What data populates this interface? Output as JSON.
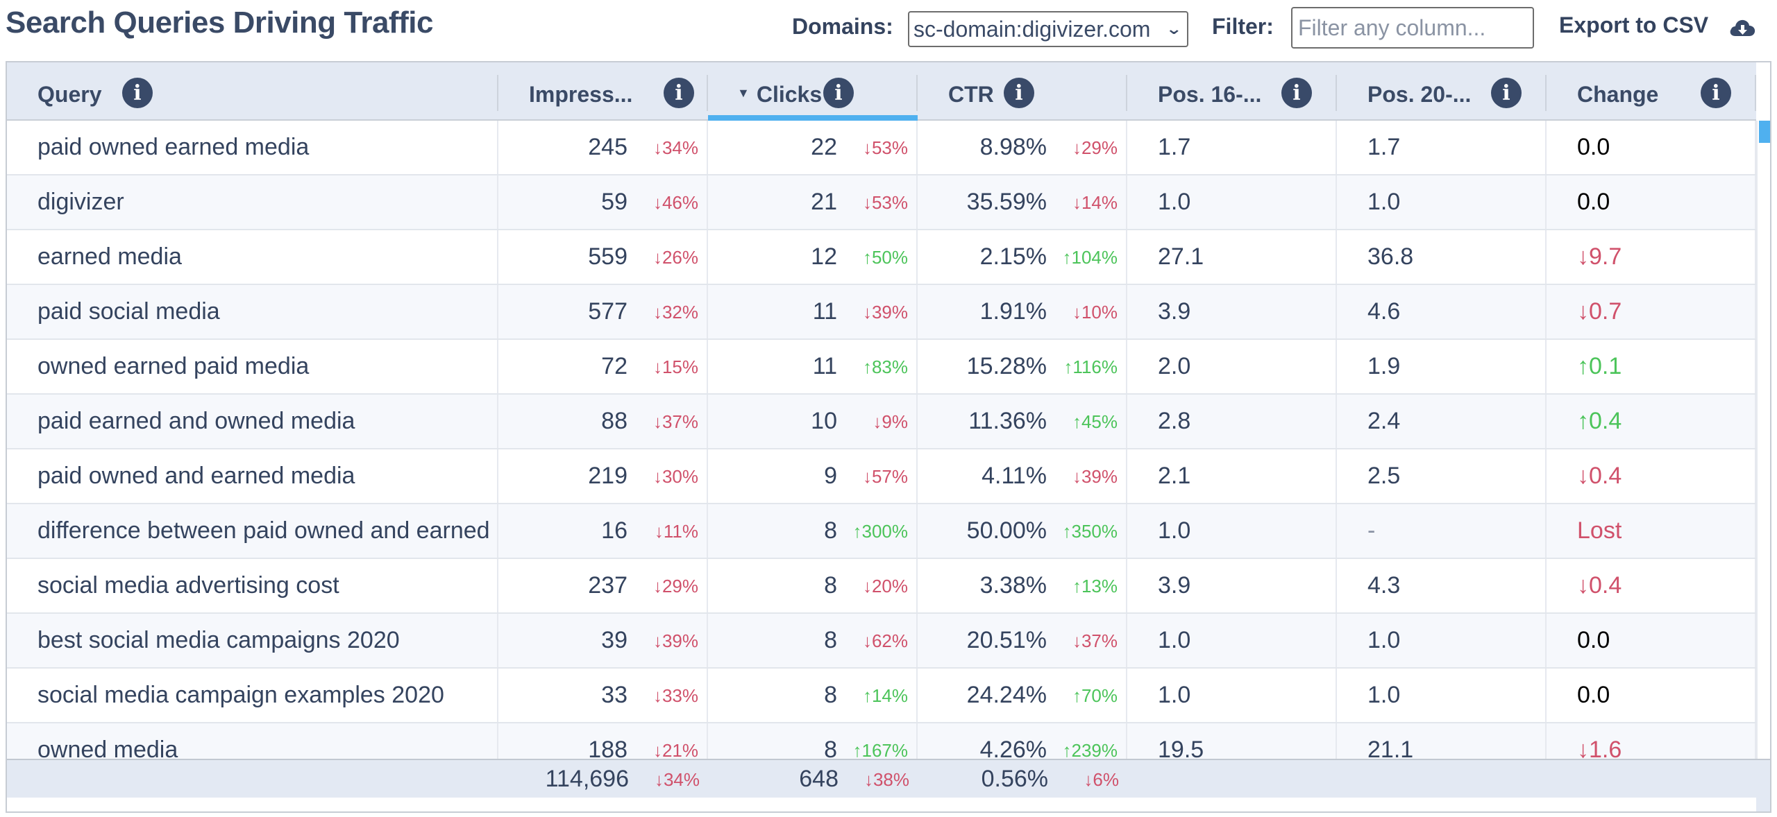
{
  "title": "Search Queries Driving Traffic",
  "toolbar": {
    "domains_label": "Domains:",
    "domain_selected": "sc-domain:digivizer.com",
    "filter_label": "Filter:",
    "filter_placeholder": "Filter any column...",
    "filter_value": "",
    "export_label": "Export to CSV",
    "export_icon": "cloud-download-icon"
  },
  "colors": {
    "accent": "#4fb0ef",
    "header_bg": "#e3e9f3",
    "text": "#34435e",
    "up": "#4cc45a",
    "down": "#d0516b"
  },
  "columns": [
    {
      "key": "query",
      "label": "Query",
      "sorted": false
    },
    {
      "key": "impressions",
      "label": "Impress...",
      "sorted": false
    },
    {
      "key": "clicks",
      "label": "Clicks",
      "sorted": true,
      "sort_dir": "desc"
    },
    {
      "key": "ctr",
      "label": "CTR",
      "sorted": false
    },
    {
      "key": "pos_a",
      "label": "Pos. 16-...",
      "sorted": false
    },
    {
      "key": "pos_b",
      "label": "Pos. 20-...",
      "sorted": false
    },
    {
      "key": "change",
      "label": "Change",
      "sorted": false
    }
  ],
  "rows": [
    {
      "query": "paid owned earned media",
      "impressions": "245",
      "imp_delta": "↓34%",
      "imp_dir": "down",
      "clicks": "22",
      "clk_delta": "↓53%",
      "clk_dir": "down",
      "ctr": "8.98%",
      "ctr_delta": "↓29%",
      "ctr_dir": "down",
      "pos_a": "1.7",
      "pos_b": "1.7",
      "change": "0.0",
      "change_dir": "neutral"
    },
    {
      "query": "digivizer",
      "impressions": "59",
      "imp_delta": "↓46%",
      "imp_dir": "down",
      "clicks": "21",
      "clk_delta": "↓53%",
      "clk_dir": "down",
      "ctr": "35.59%",
      "ctr_delta": "↓14%",
      "ctr_dir": "down",
      "pos_a": "1.0",
      "pos_b": "1.0",
      "change": "0.0",
      "change_dir": "neutral"
    },
    {
      "query": "earned media",
      "impressions": "559",
      "imp_delta": "↓26%",
      "imp_dir": "down",
      "clicks": "12",
      "clk_delta": "↑50%",
      "clk_dir": "up",
      "ctr": "2.15%",
      "ctr_delta": "↑104%",
      "ctr_dir": "up",
      "pos_a": "27.1",
      "pos_b": "36.8",
      "change": "↓9.7",
      "change_dir": "down"
    },
    {
      "query": "paid social media",
      "impressions": "577",
      "imp_delta": "↓32%",
      "imp_dir": "down",
      "clicks": "11",
      "clk_delta": "↓39%",
      "clk_dir": "down",
      "ctr": "1.91%",
      "ctr_delta": "↓10%",
      "ctr_dir": "down",
      "pos_a": "3.9",
      "pos_b": "4.6",
      "change": "↓0.7",
      "change_dir": "down"
    },
    {
      "query": "owned earned paid media",
      "impressions": "72",
      "imp_delta": "↓15%",
      "imp_dir": "down",
      "clicks": "11",
      "clk_delta": "↑83%",
      "clk_dir": "up",
      "ctr": "15.28%",
      "ctr_delta": "↑116%",
      "ctr_dir": "up",
      "pos_a": "2.0",
      "pos_b": "1.9",
      "change": "↑0.1",
      "change_dir": "up"
    },
    {
      "query": "paid earned and owned media",
      "impressions": "88",
      "imp_delta": "↓37%",
      "imp_dir": "down",
      "clicks": "10",
      "clk_delta": "↓9%",
      "clk_dir": "down",
      "ctr": "11.36%",
      "ctr_delta": "↑45%",
      "ctr_dir": "up",
      "pos_a": "2.8",
      "pos_b": "2.4",
      "change": "↑0.4",
      "change_dir": "up"
    },
    {
      "query": "paid owned and earned media",
      "impressions": "219",
      "imp_delta": "↓30%",
      "imp_dir": "down",
      "clicks": "9",
      "clk_delta": "↓57%",
      "clk_dir": "down",
      "ctr": "4.11%",
      "ctr_delta": "↓39%",
      "ctr_dir": "down",
      "pos_a": "2.1",
      "pos_b": "2.5",
      "change": "↓0.4",
      "change_dir": "down"
    },
    {
      "query": "difference between paid owned and earned media",
      "impressions": "16",
      "imp_delta": "↓11%",
      "imp_dir": "down",
      "clicks": "8",
      "clk_delta": "↑300%",
      "clk_dir": "up",
      "ctr": "50.00%",
      "ctr_delta": "↑350%",
      "ctr_dir": "up",
      "pos_a": "1.0",
      "pos_b": "-",
      "change": "Lost",
      "change_dir": "down"
    },
    {
      "query": "social media advertising cost",
      "impressions": "237",
      "imp_delta": "↓29%",
      "imp_dir": "down",
      "clicks": "8",
      "clk_delta": "↓20%",
      "clk_dir": "down",
      "ctr": "3.38%",
      "ctr_delta": "↑13%",
      "ctr_dir": "up",
      "pos_a": "3.9",
      "pos_b": "4.3",
      "change": "↓0.4",
      "change_dir": "down"
    },
    {
      "query": "best social media campaigns 2020",
      "impressions": "39",
      "imp_delta": "↓39%",
      "imp_dir": "down",
      "clicks": "8",
      "clk_delta": "↓62%",
      "clk_dir": "down",
      "ctr": "20.51%",
      "ctr_delta": "↓37%",
      "ctr_dir": "down",
      "pos_a": "1.0",
      "pos_b": "1.0",
      "change": "0.0",
      "change_dir": "neutral"
    },
    {
      "query": "social media campaign examples 2020",
      "impressions": "33",
      "imp_delta": "↓33%",
      "imp_dir": "down",
      "clicks": "8",
      "clk_delta": "↑14%",
      "clk_dir": "up",
      "ctr": "24.24%",
      "ctr_delta": "↑70%",
      "ctr_dir": "up",
      "pos_a": "1.0",
      "pos_b": "1.0",
      "change": "0.0",
      "change_dir": "neutral"
    },
    {
      "query": "owned media",
      "impressions": "188",
      "imp_delta": "↓21%",
      "imp_dir": "down",
      "clicks": "8",
      "clk_delta": "↑167%",
      "clk_dir": "up",
      "ctr": "4.26%",
      "ctr_delta": "↑239%",
      "ctr_dir": "up",
      "pos_a": "19.5",
      "pos_b": "21.1",
      "change": "↓1.6",
      "change_dir": "down"
    }
  ],
  "totals": {
    "impressions": "114,696",
    "imp_delta": "↓34%",
    "imp_dir": "down",
    "clicks": "648",
    "clk_delta": "↓38%",
    "clk_dir": "down",
    "ctr": "0.56%",
    "ctr_delta": "↓6%",
    "ctr_dir": "down"
  }
}
